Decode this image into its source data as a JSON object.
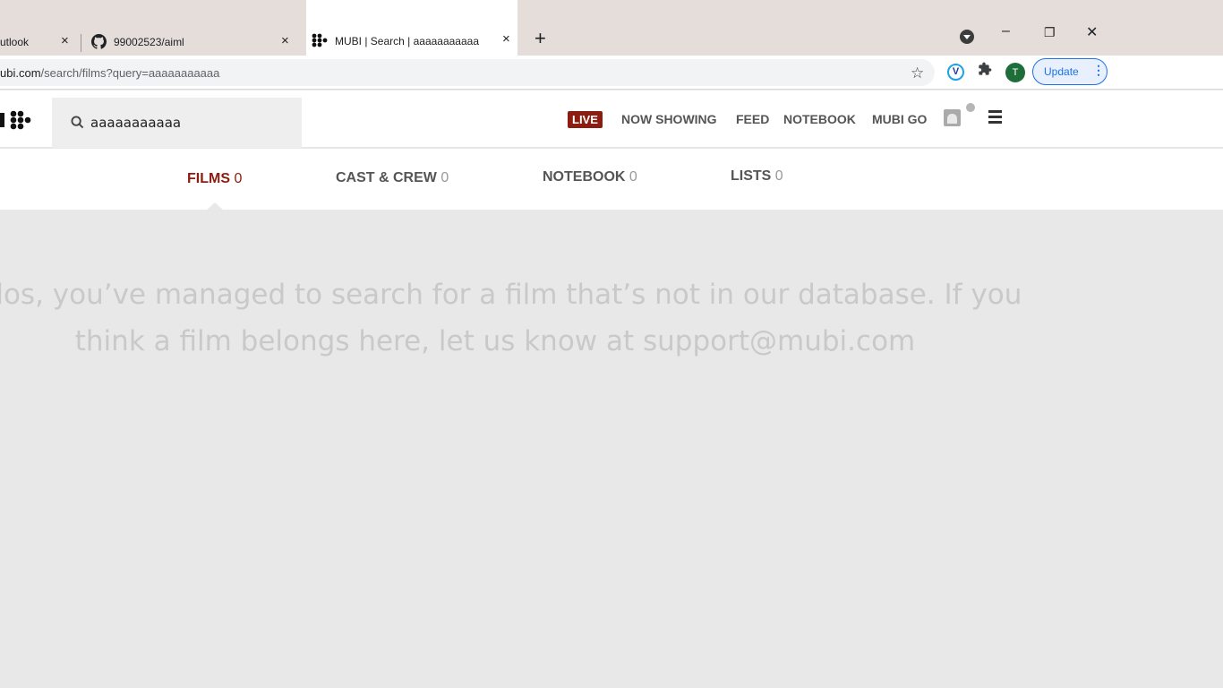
{
  "browser": {
    "tabs": [
      {
        "label": "utlook",
        "close": "×"
      },
      {
        "label": "99002523/aiml",
        "close": "×"
      },
      {
        "label": "MUBI | Search | aaaaaaaaaaa",
        "close": "×",
        "active": true
      }
    ],
    "new_tab": "+",
    "window_controls": {
      "minimize": "–",
      "restore": "❐",
      "close": "✕"
    },
    "url_host": "ubi.com",
    "url_path": "/search/films?query=aaaaaaaaaaa",
    "avatar_letter": "T",
    "extension_letter": "V",
    "update_label": "Update",
    "update_menu": "⋮",
    "icons": {
      "star": "☆",
      "puzzle": "✱"
    }
  },
  "header": {
    "search_value": "aaaaaaaaaaa",
    "live_label": "LIVE",
    "nav": [
      "NOW SHOWING",
      "FEED",
      "NOTEBOOK",
      "MUBI GO"
    ]
  },
  "result_tabs": [
    {
      "label": "FILMS",
      "count": "0",
      "active": true
    },
    {
      "label": "CAST & CREW",
      "count": "0"
    },
    {
      "label": "NOTEBOOK",
      "count": "0"
    },
    {
      "label": "LISTS",
      "count": "0"
    }
  ],
  "empty_state": {
    "line1": "udos, you’ve managed to search for a film that’s not in our database. If you",
    "line2": "think a film belongs here, let us know at support@mubi.com"
  },
  "colors": {
    "accent": "#8c1c0f",
    "update_blue": "#1a73e8",
    "page_bg": "#e8e8e8"
  }
}
